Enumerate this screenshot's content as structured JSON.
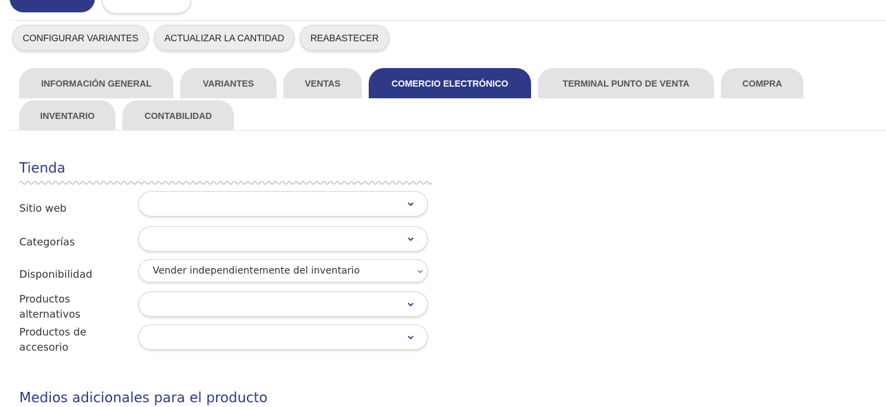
{
  "toolbar": {
    "buttons": [
      {
        "label": "CONFIGURAR VARIANTES"
      },
      {
        "label": "ACTUALIZAR LA CANTIDAD"
      },
      {
        "label": "REABASTECER"
      }
    ]
  },
  "tabs": {
    "row1": [
      {
        "label": "INFORMACIÓN GENERAL",
        "active": false
      },
      {
        "label": "VARIANTES",
        "active": false
      },
      {
        "label": "VENTAS",
        "active": false
      },
      {
        "label": "COMERCIO ELECTRÓNICO",
        "active": true
      },
      {
        "label": "TERMINAL PUNTO DE VENTA",
        "active": false
      },
      {
        "label": "COMPRA",
        "active": false
      }
    ],
    "row2": [
      {
        "label": "INVENTARIO",
        "active": false
      },
      {
        "label": "CONTABILIDAD",
        "active": false
      }
    ]
  },
  "store": {
    "title": "Tienda",
    "fields": {
      "website": {
        "label": "Sitio web",
        "value": ""
      },
      "categories": {
        "label": "Categorías",
        "value": ""
      },
      "availability": {
        "label": "Disponibilidad",
        "value": "Vender independientemente del inventario"
      },
      "alternatives": {
        "label_line1": "Productos",
        "label_line2": "alternativos",
        "value": ""
      },
      "accessories": {
        "label_line1": "Productos de",
        "label_line2": "accesorio",
        "value": ""
      }
    }
  },
  "media": {
    "title": "Medios adicionales para el producto"
  },
  "colors": {
    "accent": "#2e3a87",
    "tab_inactive": "#e3e3e6",
    "button_bg": "#ececec"
  },
  "icons": {
    "select_arrow": "chevron-down-icon"
  }
}
